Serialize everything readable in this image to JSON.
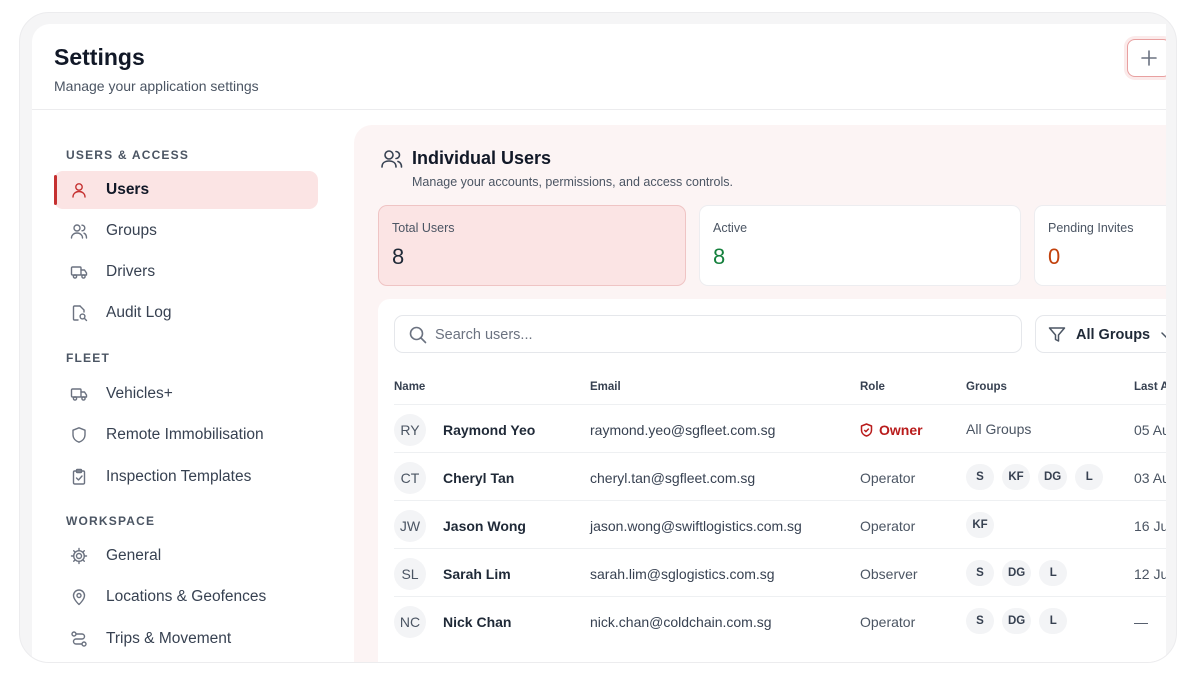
{
  "header": {
    "title": "Settings",
    "subtitle": "Manage your application settings",
    "add_label": "+"
  },
  "sidebar": {
    "sections": [
      {
        "label": "USERS & ACCESS",
        "items": [
          {
            "label": "Users",
            "icon": "user-icon",
            "active": true
          },
          {
            "label": "Groups",
            "icon": "users-icon"
          },
          {
            "label": "Drivers",
            "icon": "truck-icon"
          },
          {
            "label": "Audit Log",
            "icon": "document-search-icon"
          }
        ]
      },
      {
        "label": "FLEET",
        "items": [
          {
            "label": "Vehicles+",
            "icon": "truck-icon"
          },
          {
            "label": "Remote Immobilisation",
            "icon": "shield-icon"
          },
          {
            "label": "Inspection Templates",
            "icon": "clipboard-check-icon"
          }
        ]
      },
      {
        "label": "WORKSPACE",
        "items": [
          {
            "label": "General",
            "icon": "gear-icon"
          },
          {
            "label": "Locations & Geofences",
            "icon": "map-pin-icon"
          },
          {
            "label": "Trips & Movement",
            "icon": "route-icon"
          }
        ]
      }
    ]
  },
  "main": {
    "title": "Individual Users",
    "subtitle": "Manage your accounts, permissions, and access controls.",
    "stats": [
      {
        "label": "Total Users",
        "value": "8",
        "color": "#1f2937"
      },
      {
        "label": "Active",
        "value": "8",
        "color": "#15803d"
      },
      {
        "label": "Pending Invites",
        "value": "0",
        "color": "#c2410c"
      }
    ],
    "search": {
      "placeholder": "Search users..."
    },
    "filter": {
      "label": "All Groups"
    },
    "columns": [
      "Name",
      "Email",
      "Role",
      "Groups",
      "Last A"
    ],
    "rows": [
      {
        "initials": "RY",
        "name": "Raymond Yeo",
        "email": "raymond.yeo@sgfleet.com.sg",
        "role": "Owner",
        "owner": true,
        "groups_text": "All Groups",
        "groups": [],
        "last": "05 Au"
      },
      {
        "initials": "CT",
        "name": "Cheryl Tan",
        "email": "cheryl.tan@sgfleet.com.sg",
        "role": "Operator",
        "groups": [
          "S",
          "KF",
          "DG",
          "L"
        ],
        "last": "03 Au"
      },
      {
        "initials": "JW",
        "name": "Jason Wong",
        "email": "jason.wong@swiftlogistics.com.sg",
        "role": "Operator",
        "groups": [
          "KF"
        ],
        "last": "16 Ju"
      },
      {
        "initials": "SL",
        "name": "Sarah Lim",
        "email": "sarah.lim@sglogistics.com.sg",
        "role": "Observer",
        "groups": [
          "S",
          "DG",
          "L"
        ],
        "last": "12 Ju"
      },
      {
        "initials": "NC",
        "name": "Nick Chan",
        "email": "nick.chan@coldchain.com.sg",
        "role": "Operator",
        "groups": [
          "S",
          "DG",
          "L"
        ],
        "last": "—"
      }
    ]
  }
}
